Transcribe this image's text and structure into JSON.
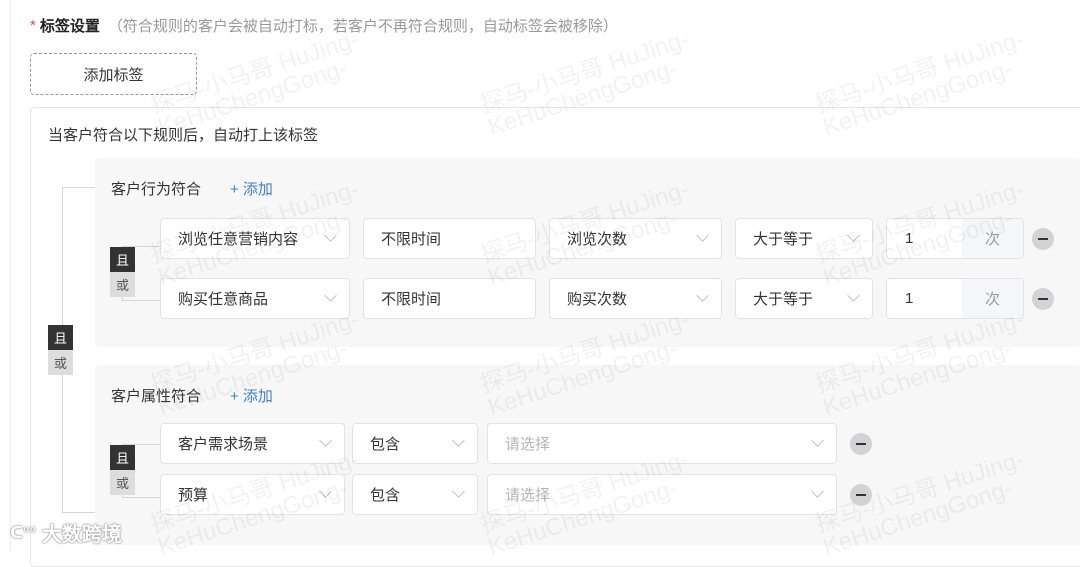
{
  "header": {
    "required_mark": "*",
    "title": "标签设置",
    "hint": "（符合规则的客户会被自动打标，若客户不再符合规则，自动标签会被移除）"
  },
  "add_tag_label": "添加标签",
  "rule_intro": "当客户符合以下规则后，自动打上该标签",
  "outer_logic": {
    "and": "且",
    "or": "或",
    "selected": "且"
  },
  "groups": [
    {
      "title": "客户行为符合",
      "add_label": "+ 添加",
      "logic": {
        "and": "且",
        "or": "或",
        "selected": "且"
      },
      "rows": [
        {
          "action": "浏览任意营销内容",
          "time": "不限时间",
          "metric": "浏览次数",
          "operator": "大于等于",
          "value": "1",
          "unit": "次"
        },
        {
          "action": "购买任意商品",
          "time": "不限时间",
          "metric": "购买次数",
          "operator": "大于等于",
          "value": "1",
          "unit": "次"
        }
      ]
    },
    {
      "title": "客户属性符合",
      "add_label": "+ 添加",
      "logic": {
        "and": "且",
        "or": "或",
        "selected": "且"
      },
      "rows": [
        {
          "attribute": "客户需求场景",
          "operator": "包含",
          "value_placeholder": "请选择"
        },
        {
          "attribute": "预算",
          "operator": "包含",
          "value_placeholder": "请选择"
        }
      ]
    }
  ],
  "watermark": {
    "text": "探马-小马哥 HuJing-\nKeHuChengGong-",
    "logo": "大数跨境"
  },
  "colors": {
    "accent": "#3f7fd8",
    "required": "#e5484d",
    "panel": "#f7f7f8"
  }
}
